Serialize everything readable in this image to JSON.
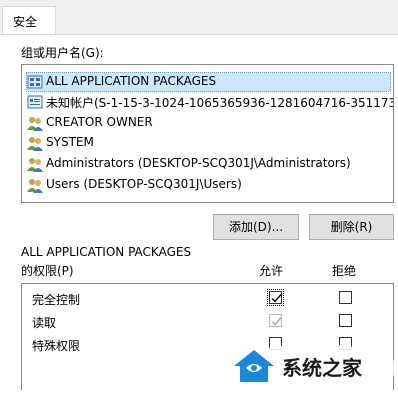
{
  "tabs": [
    {
      "label": "安全"
    }
  ],
  "groups_label": "组或用户名(G):",
  "principals": [
    {
      "name": "ALL APPLICATION PACKAGES",
      "icon": "app-packages-icon",
      "selected": true
    },
    {
      "name": "未知帐户(S-1-15-3-1024-1065365936-1281604716-351173...",
      "icon": "unknown-account-icon",
      "selected": false
    },
    {
      "name": "CREATOR OWNER",
      "icon": "users-group-icon",
      "selected": false
    },
    {
      "name": "SYSTEM",
      "icon": "users-group-icon",
      "selected": false
    },
    {
      "name": "Administrators (DESKTOP-SCQ301J\\Administrators)",
      "icon": "users-group-icon",
      "selected": false
    },
    {
      "name": "Users (DESKTOP-SCQ301J\\Users)",
      "icon": "users-group-icon",
      "selected": false
    }
  ],
  "buttons": {
    "add": "添加(D)...",
    "remove": "删除(R)"
  },
  "permissions_for": "ALL APPLICATION PACKAGES",
  "permissions_label": "的权限(P)",
  "columns": {
    "allow": "允许",
    "deny": "拒绝"
  },
  "permissions": [
    {
      "name": "完全控制",
      "allow": "checked",
      "deny": "unchecked"
    },
    {
      "name": "读取",
      "allow": "checked-disabled",
      "deny": "unchecked"
    },
    {
      "name": "特殊权限",
      "allow": "unchecked",
      "deny": "unchecked"
    }
  ],
  "watermark": {
    "text": "系统之家",
    "icon": "house-logo-icon"
  },
  "colors": {
    "selection": "#cce8ff",
    "button": "#e1e1e1",
    "border": "#828790"
  }
}
